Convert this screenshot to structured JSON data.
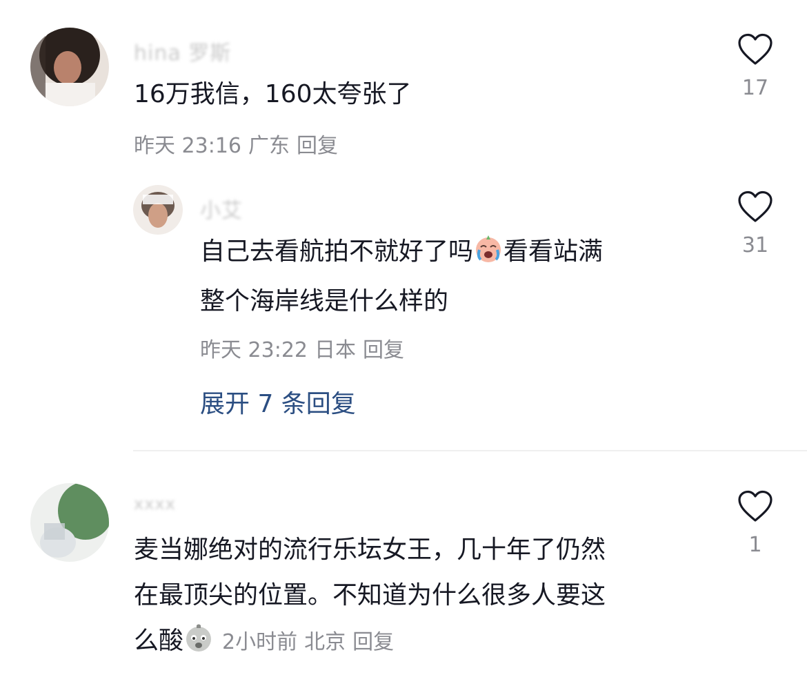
{
  "comments": [
    {
      "username": "hina 罗斯",
      "text": "16万我信，160太夸张了",
      "time": "昨天 23:16",
      "location": "广东",
      "reply_label": "回复",
      "likes": "17",
      "avatar_icon": "user-avatar-dark-hair",
      "replies": [
        {
          "username": "小艾",
          "text_part1": "自己去看航拍不就好了吗",
          "emoji": "crying-face-emoji",
          "text_part2_line1": "看看站满",
          "text_line2": "整个海岸线是什么样的",
          "time": "昨天 23:22",
          "location": "日本",
          "reply_label": "回复",
          "likes": "31",
          "avatar_icon": "user-avatar-girl"
        }
      ],
      "expand_label": "展开 7 条回复"
    },
    {
      "username": "xxxx",
      "text_line1": "麦当娜绝对的流行乐坛女王，几十年了仍然",
      "text_line2": "在最顶尖的位置。不知道为什么很多人要这",
      "text_line3": "么酸",
      "emoji": "sour-face-emoji",
      "time": "2小时前",
      "location": "北京",
      "reply_label": "回复",
      "likes": "1",
      "avatar_icon": "user-avatar-green-plant"
    }
  ],
  "colors": {
    "text": "#161823",
    "meta": "#8a8b91",
    "link": "#2b4e82",
    "divider": "#efefef"
  }
}
